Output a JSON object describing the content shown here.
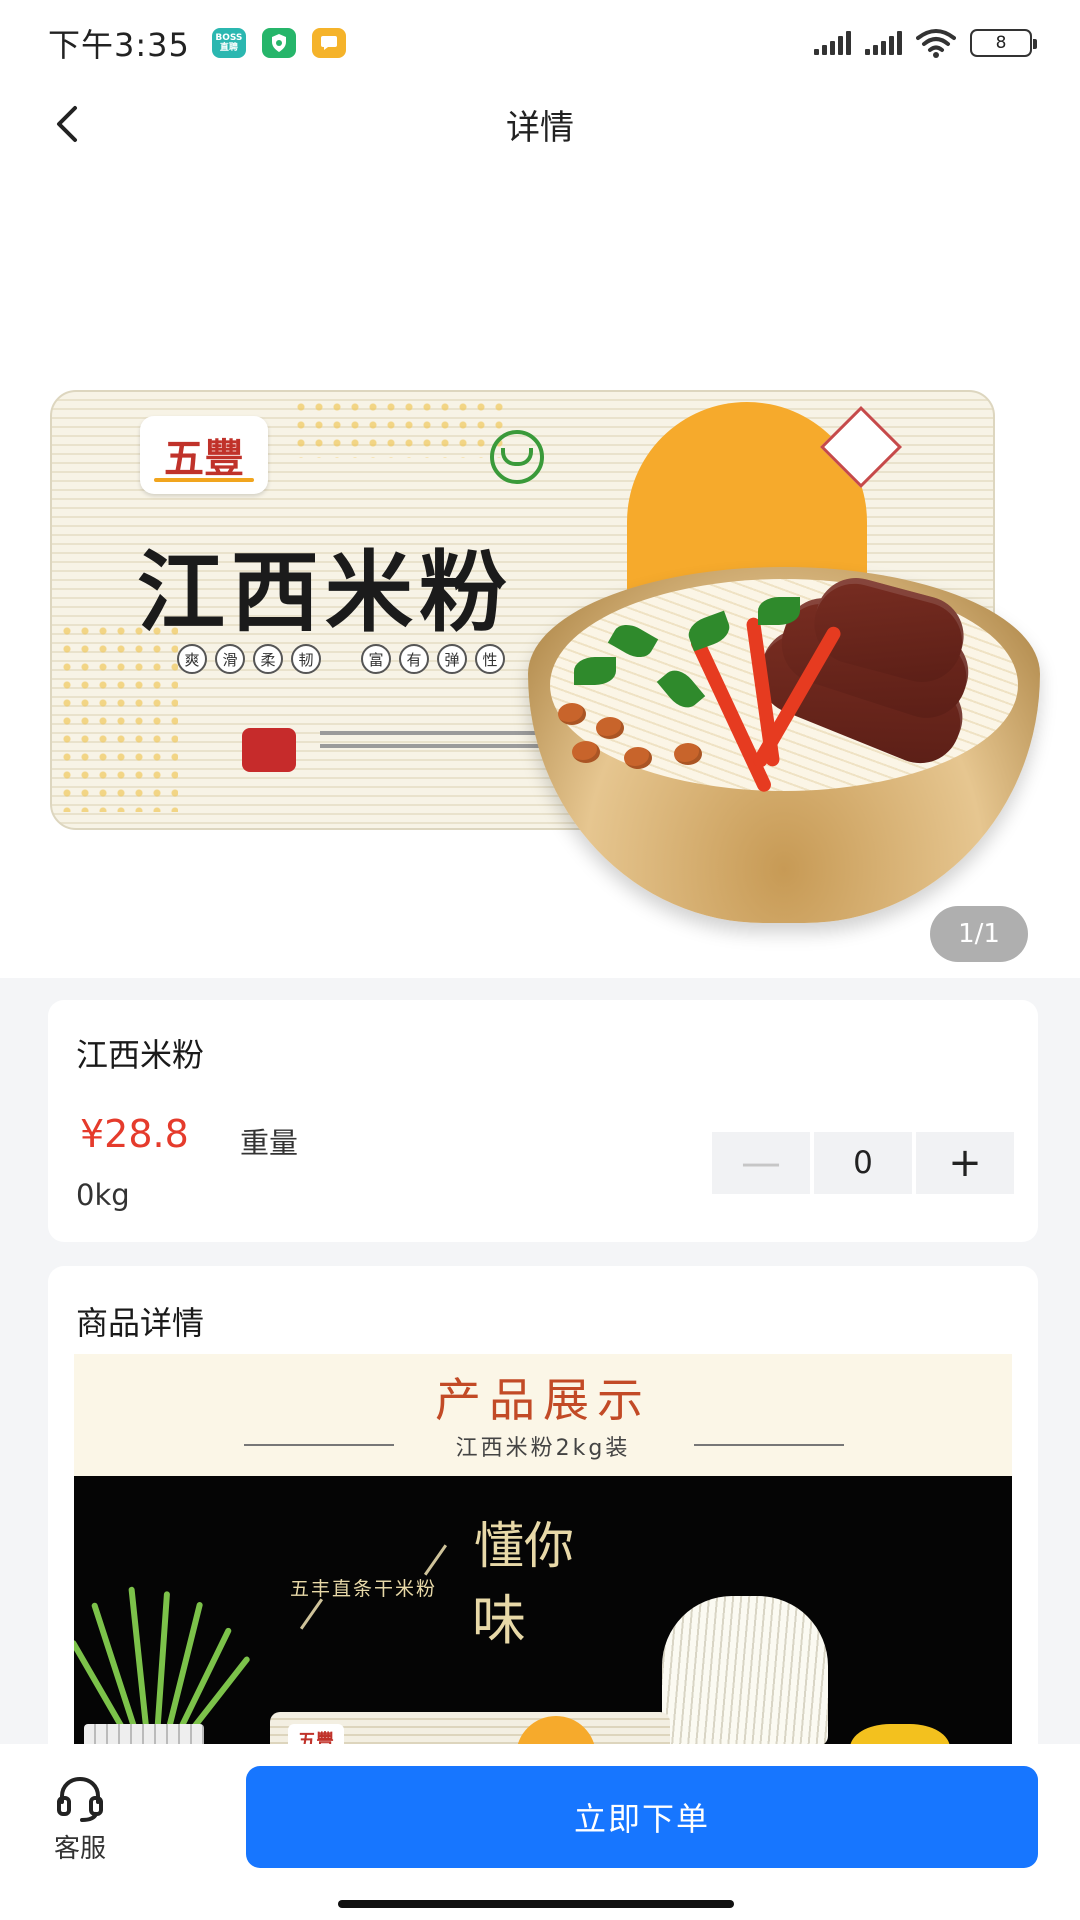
{
  "status_bar": {
    "time": "下午3:35",
    "battery": "8",
    "apps": [
      {
        "name": "boss-app-icon",
        "label": "BOSS 直聘",
        "color": "#2bb7b0"
      },
      {
        "name": "shield-app-icon",
        "label": "",
        "color": "#26b56a"
      },
      {
        "name": "message-app-icon",
        "label": "",
        "color": "#f5b32a"
      }
    ]
  },
  "nav": {
    "title": "详情",
    "back_icon": "chevron-left-icon"
  },
  "gallery": {
    "pager": "1/1",
    "package": {
      "brand": "五豐",
      "product_title": "江西米粉",
      "tagline": [
        "爽",
        "滑",
        "柔",
        "韧",
        "富",
        "有",
        "弹",
        "性"
      ]
    }
  },
  "product": {
    "name": "江西米粉",
    "price": "¥28.8",
    "weight_label": "重量",
    "weight_value": "0kg",
    "quantity": "0",
    "minus_symbol": "—",
    "plus_symbol": "+"
  },
  "details": {
    "section_title": "商品详情",
    "banner_title": "产品展示",
    "banner_subtitle": "江西米粉2kg装",
    "showcase": {
      "slogan": "五丰直条干米粉",
      "headline_1": "懂你",
      "headline_2": "味",
      "package_brand": "五豐"
    }
  },
  "bottom_bar": {
    "customer_service_label": "客服",
    "customer_service_icon": "headset-icon",
    "order_button_label": "立即下单"
  },
  "colors": {
    "accent": "#1776ff",
    "price": "#e53b2c",
    "background": "#f4f5f7"
  }
}
